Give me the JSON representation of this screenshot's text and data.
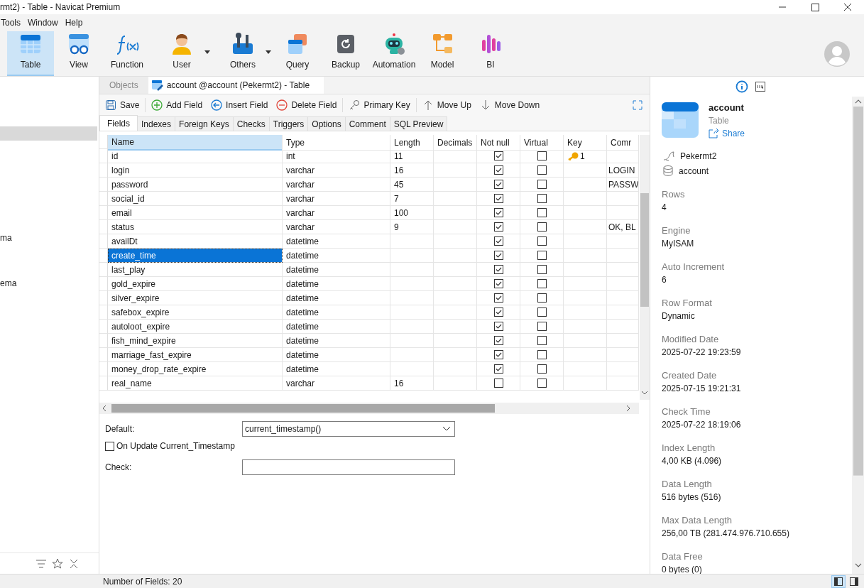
{
  "window": {
    "title": "rmt2) - Table - Navicat Premium"
  },
  "menu": [
    "Tools",
    "Window",
    "Help"
  ],
  "toolbar": [
    {
      "label": "Table",
      "kind": "table",
      "selected": true,
      "has_menu": false
    },
    {
      "label": "View",
      "kind": "view",
      "selected": false,
      "has_menu": false
    },
    {
      "label": "Function",
      "kind": "function",
      "selected": false,
      "has_menu": false
    },
    {
      "label": "User",
      "kind": "user",
      "selected": false,
      "has_menu": true
    },
    {
      "label": "Others",
      "kind": "others",
      "selected": false,
      "has_menu": true
    },
    {
      "label": "Query",
      "kind": "query",
      "selected": false,
      "has_menu": false
    },
    {
      "label": "Backup",
      "kind": "backup",
      "selected": false,
      "has_menu": false
    },
    {
      "label": "Automation",
      "kind": "automation",
      "selected": false,
      "has_menu": false
    },
    {
      "label": "Model",
      "kind": "model",
      "selected": false,
      "has_menu": false
    },
    {
      "label": "BI",
      "kind": "bi",
      "selected": false,
      "has_menu": false
    }
  ],
  "sidebar": {
    "items": [
      {
        "label": "ma"
      },
      {
        "label": "ema"
      }
    ]
  },
  "document_tabs": [
    {
      "label": "Objects",
      "selected": false
    },
    {
      "label": "account @account (Pekermt2) - Table",
      "selected": true
    }
  ],
  "actions": [
    {
      "label": "Save",
      "kind": "save"
    },
    {
      "label": "Add Field",
      "kind": "add"
    },
    {
      "label": "Insert Field",
      "kind": "insert"
    },
    {
      "label": "Delete Field",
      "kind": "delete"
    },
    {
      "label": "Primary Key",
      "kind": "key"
    },
    {
      "label": "Move Up",
      "kind": "up"
    },
    {
      "label": "Move Down",
      "kind": "down"
    }
  ],
  "design_tabs": [
    {
      "label": "Fields",
      "selected": true
    },
    {
      "label": "Indexes",
      "selected": false
    },
    {
      "label": "Foreign Keys",
      "selected": false
    },
    {
      "label": "Checks",
      "selected": false
    },
    {
      "label": "Triggers",
      "selected": false
    },
    {
      "label": "Options",
      "selected": false
    },
    {
      "label": "Comment",
      "selected": false
    },
    {
      "label": "SQL Preview",
      "selected": false
    }
  ],
  "table": {
    "columns": [
      "Name",
      "Type",
      "Length",
      "Decimals",
      "Not null",
      "Virtual",
      "Key",
      "Comr"
    ],
    "rows": [
      {
        "name": "id",
        "type": "int",
        "length": "11",
        "not_null": true,
        "virtual": false,
        "key": "1",
        "comment": "",
        "selected": false
      },
      {
        "name": "login",
        "type": "varchar",
        "length": "16",
        "not_null": true,
        "virtual": false,
        "key": "",
        "comment": "LOGIN",
        "selected": false
      },
      {
        "name": "password",
        "type": "varchar",
        "length": "45",
        "not_null": true,
        "virtual": false,
        "key": "",
        "comment": "PASSW",
        "selected": false
      },
      {
        "name": "social_id",
        "type": "varchar",
        "length": "7",
        "not_null": true,
        "virtual": false,
        "key": "",
        "comment": "",
        "selected": false
      },
      {
        "name": "email",
        "type": "varchar",
        "length": "100",
        "not_null": true,
        "virtual": false,
        "key": "",
        "comment": "",
        "selected": false
      },
      {
        "name": "status",
        "type": "varchar",
        "length": "9",
        "not_null": true,
        "virtual": false,
        "key": "",
        "comment": "OK, BL",
        "selected": false
      },
      {
        "name": "availDt",
        "type": "datetime",
        "length": "",
        "not_null": true,
        "virtual": false,
        "key": "",
        "comment": "",
        "selected": false
      },
      {
        "name": "create_time",
        "type": "datetime",
        "length": "",
        "not_null": true,
        "virtual": false,
        "key": "",
        "comment": "",
        "selected": true
      },
      {
        "name": "last_play",
        "type": "datetime",
        "length": "",
        "not_null": true,
        "virtual": false,
        "key": "",
        "comment": "",
        "selected": false
      },
      {
        "name": "gold_expire",
        "type": "datetime",
        "length": "",
        "not_null": true,
        "virtual": false,
        "key": "",
        "comment": "",
        "selected": false
      },
      {
        "name": "silver_expire",
        "type": "datetime",
        "length": "",
        "not_null": true,
        "virtual": false,
        "key": "",
        "comment": "",
        "selected": false
      },
      {
        "name": "safebox_expire",
        "type": "datetime",
        "length": "",
        "not_null": true,
        "virtual": false,
        "key": "",
        "comment": "",
        "selected": false
      },
      {
        "name": "autoloot_expire",
        "type": "datetime",
        "length": "",
        "not_null": true,
        "virtual": false,
        "key": "",
        "comment": "",
        "selected": false
      },
      {
        "name": "fish_mind_expire",
        "type": "datetime",
        "length": "",
        "not_null": true,
        "virtual": false,
        "key": "",
        "comment": "",
        "selected": false
      },
      {
        "name": "marriage_fast_expire",
        "type": "datetime",
        "length": "",
        "not_null": true,
        "virtual": false,
        "key": "",
        "comment": "",
        "selected": false
      },
      {
        "name": "money_drop_rate_expire",
        "type": "datetime",
        "length": "",
        "not_null": true,
        "virtual": false,
        "key": "",
        "comment": "",
        "selected": false
      },
      {
        "name": "real_name",
        "type": "varchar",
        "length": "16",
        "not_null": false,
        "virtual": false,
        "key": "",
        "comment": "",
        "selected": false
      }
    ]
  },
  "field_options": {
    "default_label": "Default:",
    "default_value": "current_timestamp()",
    "on_update": {
      "label": "On Update Current_Timestamp",
      "checked": false
    },
    "check_label": "Check:"
  },
  "info_panel": {
    "tabs": [
      {
        "kind": "info",
        "selected": true
      },
      {
        "kind": "ddl",
        "selected": false
      }
    ],
    "object": {
      "name": "account",
      "type": "Table",
      "share": "Share"
    },
    "connection": "Pekermt2",
    "database": "account",
    "properties": [
      {
        "label": "Rows",
        "value": "4"
      },
      {
        "label": "Engine",
        "value": "MyISAM"
      },
      {
        "label": "Auto Increment",
        "value": "6"
      },
      {
        "label": "Row Format",
        "value": "Dynamic"
      },
      {
        "label": "Modified Date",
        "value": "2025-07-22 19:23:59"
      },
      {
        "label": "Created Date",
        "value": "2025-07-15 19:21:31"
      },
      {
        "label": "Check Time",
        "value": "2025-07-22 18:19:06"
      },
      {
        "label": "Index Length",
        "value": "4,00 KB (4.096)"
      },
      {
        "label": "Data Length",
        "value": "516 bytes (516)"
      },
      {
        "label": "Max Data Length",
        "value": "256,00 TB (281.474.976.710.655)"
      },
      {
        "label": "Data Free",
        "value": "0 bytes (0)"
      }
    ]
  },
  "status_bar": {
    "text": "Number of Fields: 20",
    "views": [
      {
        "kind": "left",
        "selected": true
      },
      {
        "kind": "right",
        "selected": false
      }
    ]
  }
}
